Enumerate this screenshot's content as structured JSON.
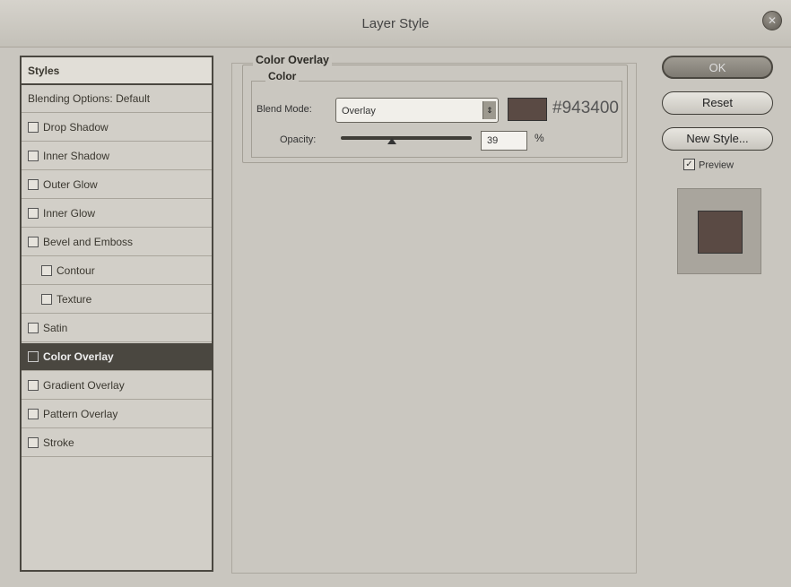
{
  "window": {
    "title": "Layer Style"
  },
  "styles_panel": {
    "header": "Styles",
    "items": [
      {
        "label": "Blending Options: Default",
        "checkbox": false,
        "indent": 0,
        "selected": false
      },
      {
        "label": "Drop Shadow",
        "checkbox": true,
        "indent": 0,
        "selected": false
      },
      {
        "label": "Inner Shadow",
        "checkbox": true,
        "indent": 0,
        "selected": false
      },
      {
        "label": "Outer Glow",
        "checkbox": true,
        "indent": 0,
        "selected": false
      },
      {
        "label": "Inner Glow",
        "checkbox": true,
        "indent": 0,
        "selected": false
      },
      {
        "label": "Bevel and Emboss",
        "checkbox": true,
        "indent": 0,
        "selected": false
      },
      {
        "label": "Contour",
        "checkbox": true,
        "indent": 1,
        "selected": false
      },
      {
        "label": "Texture",
        "checkbox": true,
        "indent": 1,
        "selected": false
      },
      {
        "label": "Satin",
        "checkbox": true,
        "indent": 0,
        "selected": false
      },
      {
        "label": "Color Overlay",
        "checkbox": true,
        "indent": 0,
        "selected": true
      },
      {
        "label": "Gradient Overlay",
        "checkbox": true,
        "indent": 0,
        "selected": false
      },
      {
        "label": "Pattern Overlay",
        "checkbox": true,
        "indent": 0,
        "selected": false
      },
      {
        "label": "Stroke",
        "checkbox": true,
        "indent": 0,
        "selected": false
      }
    ]
  },
  "color_overlay": {
    "section_title": "Color Overlay",
    "group_title": "Color",
    "blend_mode_label": "Blend Mode:",
    "blend_mode_value": "Overlay",
    "color_hex": "#943400",
    "color_swatch": "#5a4a44",
    "opacity_label": "Opacity:",
    "opacity_value": "39",
    "opacity_unit": "%",
    "opacity_fraction": 0.39
  },
  "buttons": {
    "ok": "OK",
    "reset": "Reset",
    "new_style": "New Style...",
    "preview_label": "Preview",
    "preview_checked": true
  },
  "preview_swatch": "#5a4a44"
}
